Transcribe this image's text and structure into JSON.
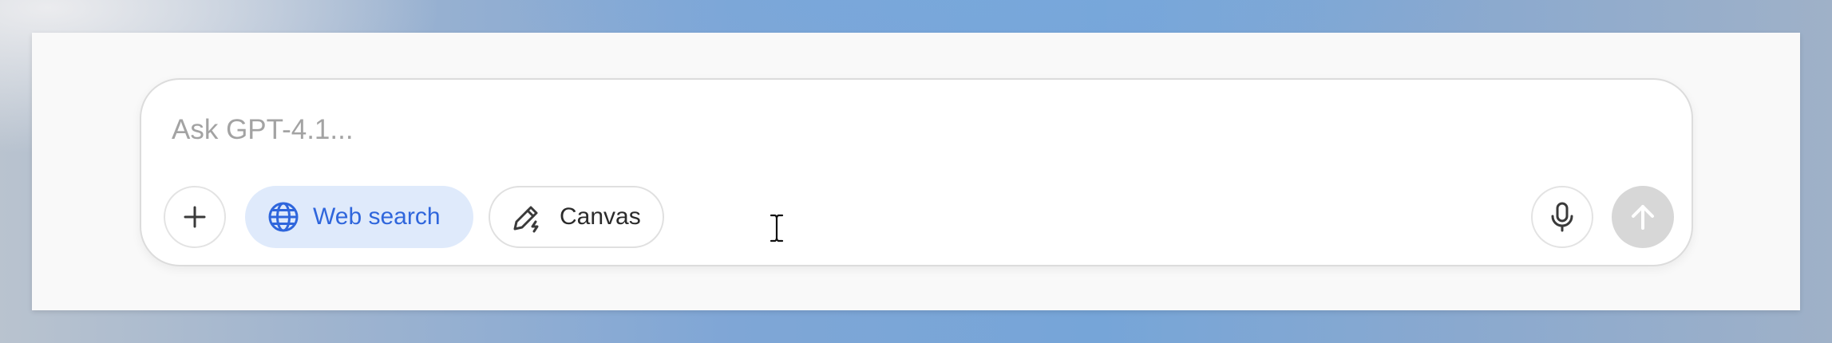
{
  "composer": {
    "placeholder": "Ask GPT-4.1...",
    "value": ""
  },
  "toolbar": {
    "add": {
      "icon": "plus-icon"
    },
    "web_search": {
      "label": "Web search",
      "icon": "globe-icon",
      "active": true
    },
    "canvas": {
      "label": "Canvas",
      "icon": "pencil-sparkle-icon",
      "active": false
    },
    "mic": {
      "icon": "microphone-icon"
    },
    "send": {
      "icon": "arrow-up-icon",
      "enabled": false
    }
  },
  "colors": {
    "accent": "#2f66dc",
    "active_pill_bg": "#dfeafb",
    "disabled_send_bg": "#d7d7d7",
    "placeholder": "#a3a3a3"
  }
}
